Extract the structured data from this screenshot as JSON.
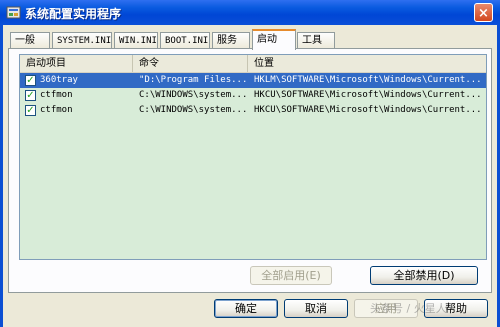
{
  "window": {
    "title": "系统配置实用程序",
    "close_glyph": "×"
  },
  "tabs": [
    {
      "label": "一般"
    },
    {
      "label": "SYSTEM.INI"
    },
    {
      "label": "WIN.INI"
    },
    {
      "label": "BOOT.INI"
    },
    {
      "label": "服务"
    },
    {
      "label": "启动",
      "active": true
    },
    {
      "label": "工具"
    }
  ],
  "startup_list": {
    "columns": [
      "启动项目",
      "命令",
      "位置"
    ],
    "rows": [
      {
        "checked": true,
        "item": "360tray",
        "command": "\"D:\\Program Files...",
        "location": "HKLM\\SOFTWARE\\Microsoft\\Windows\\Current...",
        "selected": true
      },
      {
        "checked": true,
        "item": "ctfmon",
        "command": "C:\\WINDOWS\\system...",
        "location": "HKCU\\SOFTWARE\\Microsoft\\Windows\\Current..."
      },
      {
        "checked": true,
        "item": "ctfmon",
        "command": "C:\\WINDOWS\\system...",
        "location": "HKCU\\SOFTWARE\\Microsoft\\Windows\\Current..."
      }
    ]
  },
  "panel_buttons": {
    "enable_all": "全部启用(E)",
    "disable_all": "全部禁用(D)"
  },
  "dialog_buttons": {
    "ok": "确定",
    "cancel": "取消",
    "apply": "应用",
    "help": "帮助"
  },
  "watermark": "头条号 / 火星人"
}
